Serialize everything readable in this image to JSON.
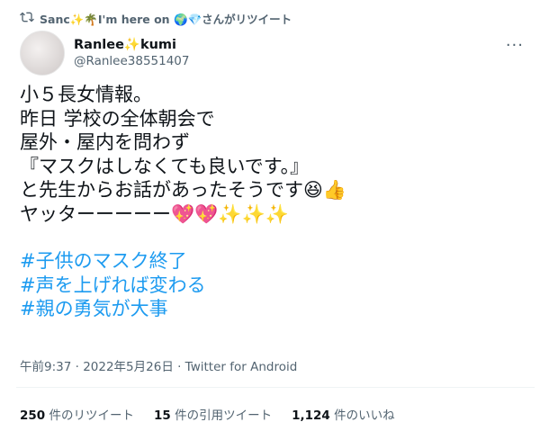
{
  "retweet": {
    "text": "Sanc✨🌴I'm here on 🌍💎さんがリツイート"
  },
  "author": {
    "display_name": "Ranlee✨kumi",
    "handle": "@Ranlee38551407",
    "more_icon": "more-icon"
  },
  "tweet": {
    "lines": [
      "小５長女情報。",
      "昨日 学校の全体朝会で",
      "屋外・屋内を問わず",
      "『マスクはしなくても良いです。』",
      "と先生からお話があったそうです😆👍",
      "ヤッターーーーー💖💖✨✨✨"
    ],
    "hashtags": [
      "#子供のマスク終了",
      "#声を上げれば変わる",
      "#親の勇気が大事"
    ]
  },
  "meta": {
    "timestamp": "午前9:37 · 2022年5月26日 · Twitter for Android"
  },
  "stats": {
    "retweets_count": "250",
    "retweets_label": "件のリツイート",
    "quotes_count": "15",
    "quotes_label": "件の引用ツイート",
    "likes_count": "1,124",
    "likes_label": "件のいいね"
  },
  "colors": {
    "hashtag": "#1d9bf0",
    "secondary_text": "#536471",
    "primary_text": "#0f1419"
  }
}
